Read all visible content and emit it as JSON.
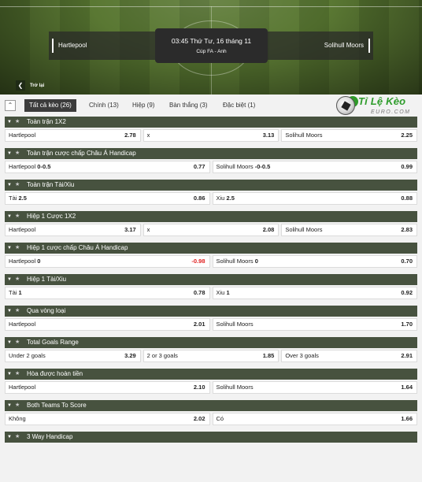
{
  "match": {
    "home": "Hartlepool",
    "away": "Solihull Moors",
    "time": "03:45 Thứ Tư, 16 tháng 11",
    "competition": "Cúp FA - Anh",
    "back_label": "Trở lại",
    "back_icon": "chevron-left-icon"
  },
  "tabs": [
    {
      "label": "Tất cả kèo (26)",
      "active": true
    },
    {
      "label": "Chính (13)"
    },
    {
      "label": "Hiệp (9)"
    },
    {
      "label": "Bàn thắng (3)"
    },
    {
      "label": "Đặc biệt (1)"
    }
  ],
  "logo": {
    "name": "Tỉ Lệ Kèo",
    "sub": "EURO.COM"
  },
  "colors": {
    "header": "#47523f",
    "accent_green": "#2e9c2b",
    "negative": "#e02020"
  },
  "markets": [
    {
      "title": "Toàn trận 1X2",
      "outcomes": [
        {
          "label": "Hartlepool",
          "odd": "2.78"
        },
        {
          "label": "x",
          "odd": "3.13"
        },
        {
          "label": "Solihull Moors",
          "odd": "2.25"
        }
      ]
    },
    {
      "title": "Toàn trận cược chấp Châu Á Handicap",
      "outcomes": [
        {
          "label": "Hartlepool",
          "line": "0-0.5",
          "odd": "0.77"
        },
        {
          "label": "Solihull Moors",
          "line": "-0-0.5",
          "odd": "0.99"
        }
      ]
    },
    {
      "title": "Toàn trận Tài/Xiu",
      "outcomes": [
        {
          "label": "Tài",
          "line": "2.5",
          "odd": "0.86"
        },
        {
          "label": "Xiu",
          "line": "2.5",
          "odd": "0.88"
        }
      ]
    },
    {
      "title": "Hiệp 1 Cược 1X2",
      "outcomes": [
        {
          "label": "Hartlepool",
          "odd": "3.17"
        },
        {
          "label": "x",
          "odd": "2.08"
        },
        {
          "label": "Solihull Moors",
          "odd": "2.83"
        }
      ]
    },
    {
      "title": "Hiệp 1 cược chấp Châu Á Handicap",
      "outcomes": [
        {
          "label": "Hartlepool",
          "line": "0",
          "odd": "-0.98",
          "negative": true
        },
        {
          "label": "Solihull Moors",
          "line": "0",
          "odd": "0.70"
        }
      ]
    },
    {
      "title": "Hiệp 1 Tài/Xiu",
      "outcomes": [
        {
          "label": "Tài",
          "line": "1",
          "odd": "0.78"
        },
        {
          "label": "Xiu",
          "line": "1",
          "odd": "0.92"
        }
      ]
    },
    {
      "title": "Qua vòng loại",
      "outcomes": [
        {
          "label": "Hartlepool",
          "odd": "2.01"
        },
        {
          "label": "Solihull Moors",
          "odd": "1.70"
        }
      ]
    },
    {
      "title": "Total Goals Range",
      "outcomes": [
        {
          "label": "Under 2 goals",
          "odd": "3.29"
        },
        {
          "label": "2 or 3 goals",
          "odd": "1.85"
        },
        {
          "label": "Over 3 goals",
          "odd": "2.91"
        }
      ]
    },
    {
      "title": "Hòa được hoàn tiền",
      "outcomes": [
        {
          "label": "Hartlepool",
          "odd": "2.10"
        },
        {
          "label": "Solihull Moors",
          "odd": "1.64"
        }
      ]
    },
    {
      "title": "Both Teams To Score",
      "outcomes": [
        {
          "label": "Không",
          "odd": "2.02"
        },
        {
          "label": "Có",
          "odd": "1.66"
        }
      ]
    },
    {
      "title": "3 Way Handicap",
      "outcomes": []
    }
  ]
}
